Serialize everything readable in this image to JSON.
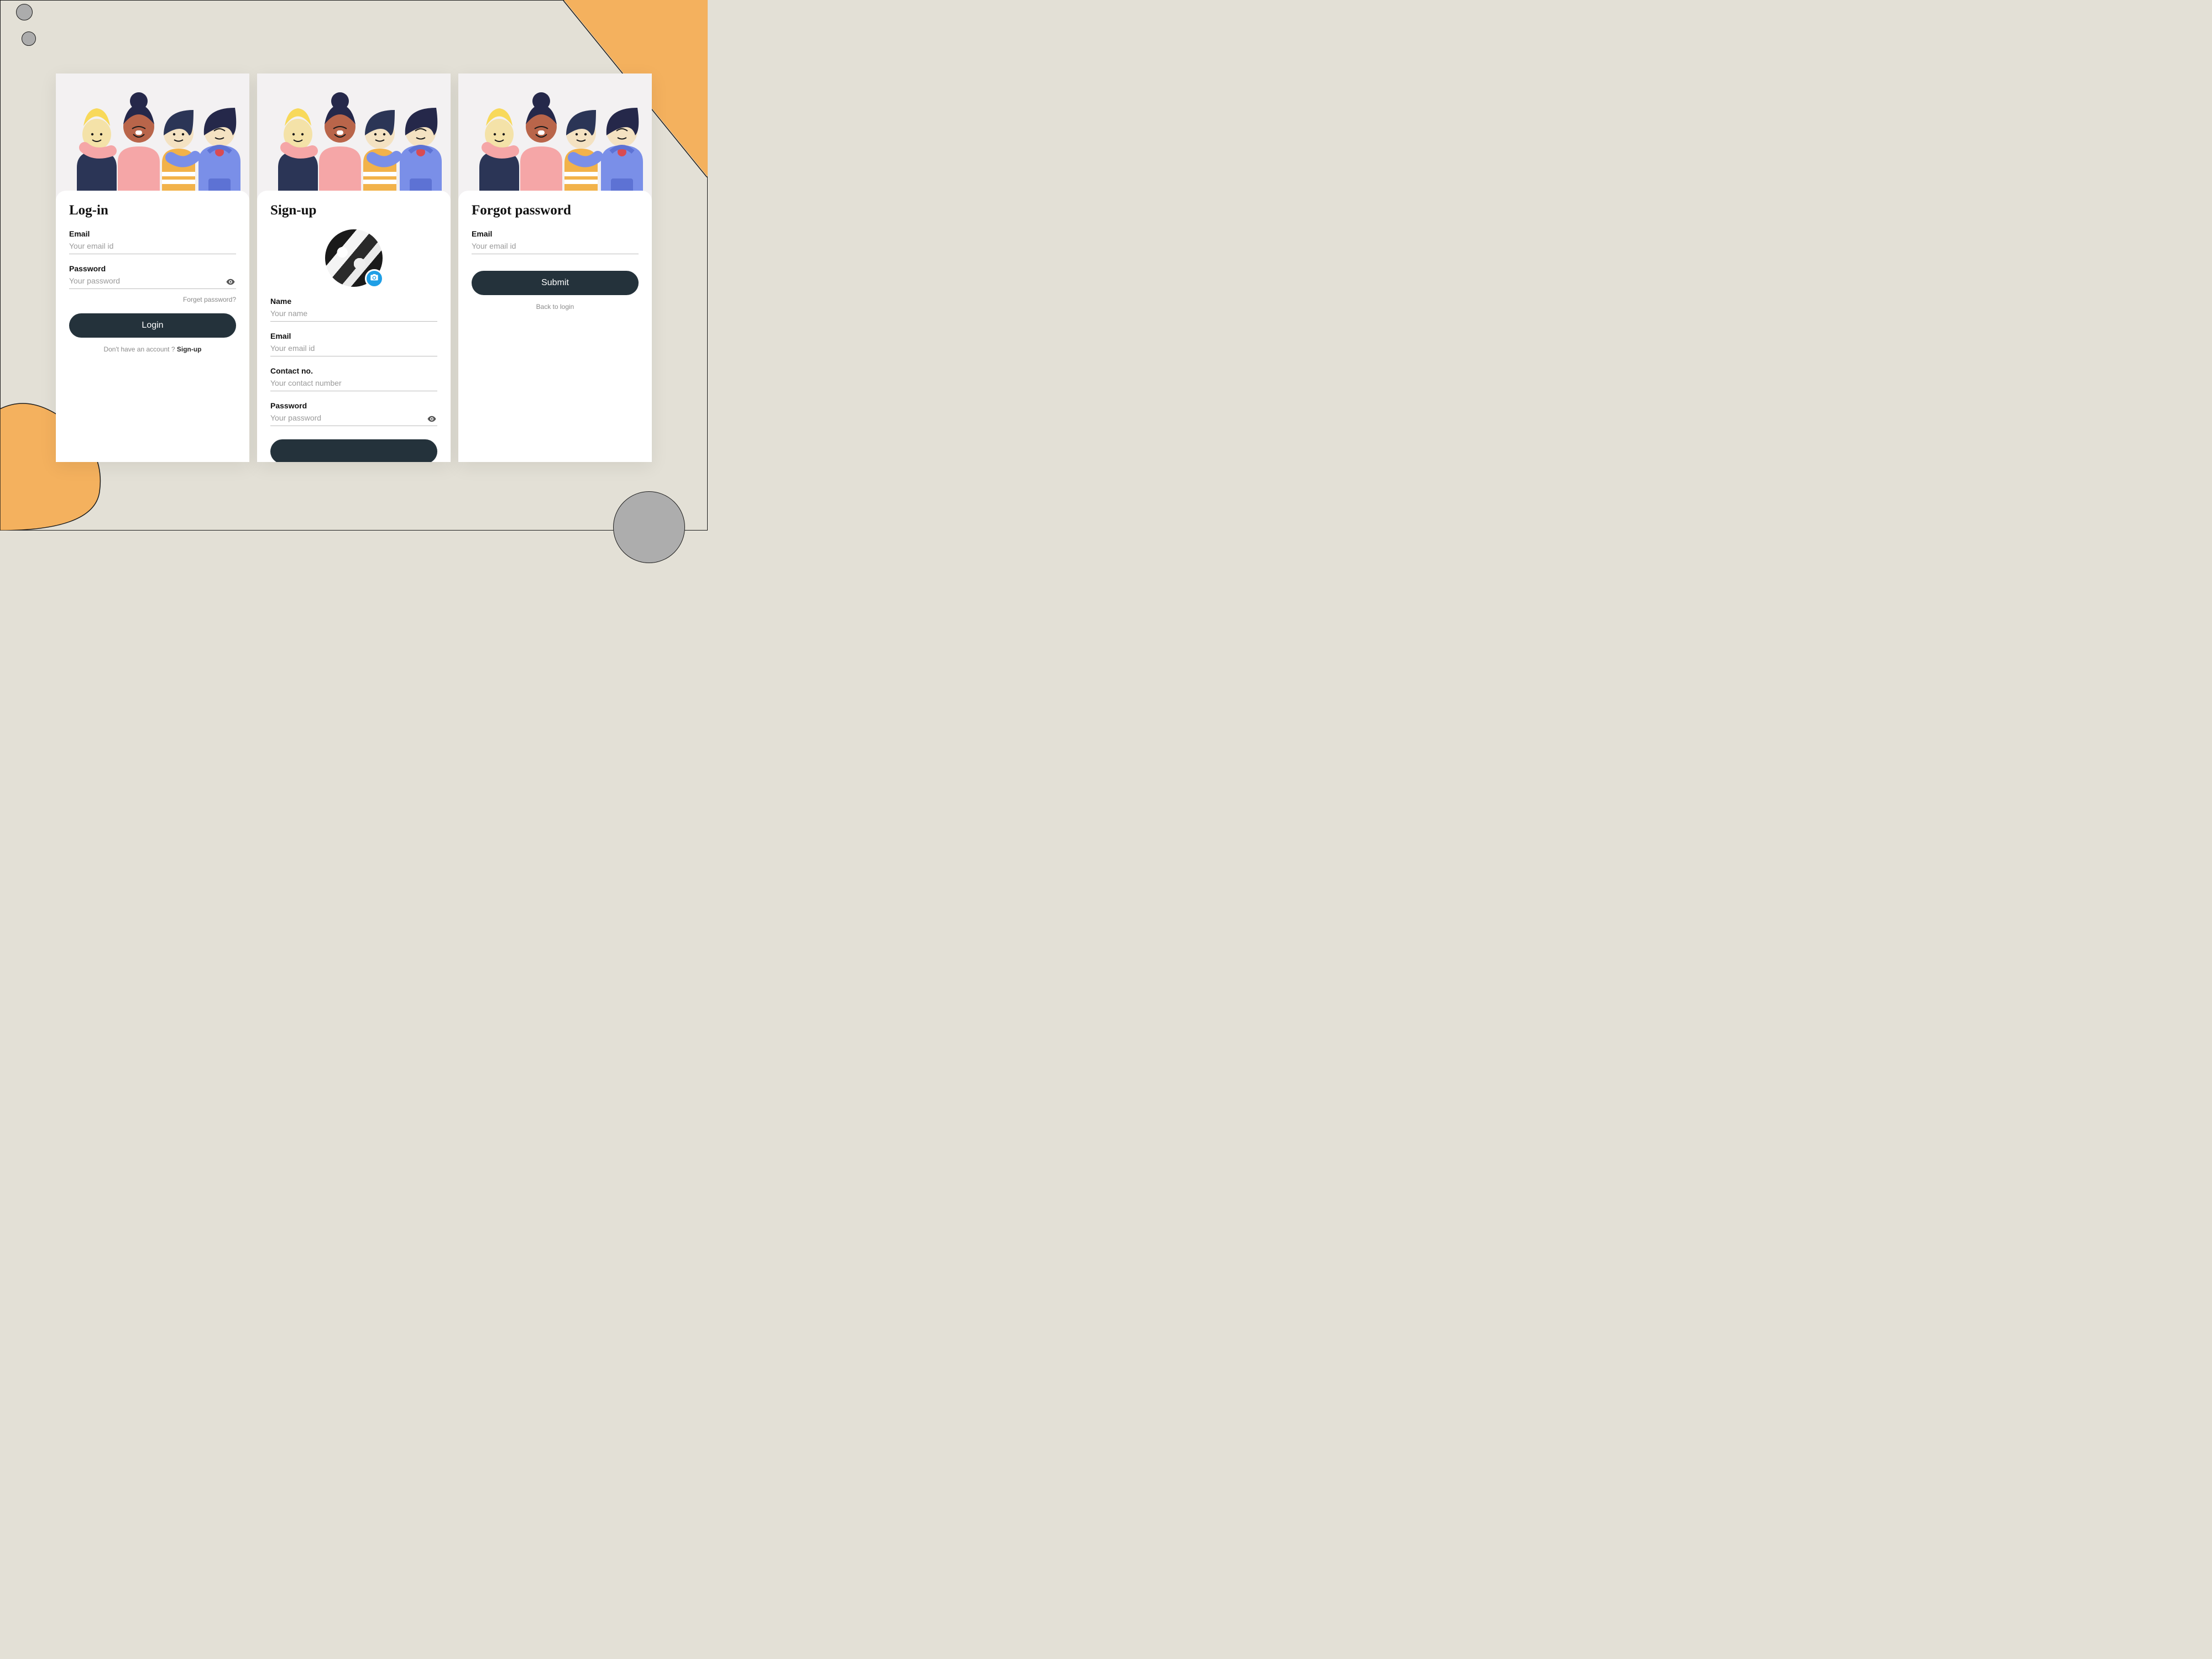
{
  "screens": {
    "login": {
      "title": "Log-in",
      "email_label": "Email",
      "email_placeholder": "Your email id",
      "password_label": "Password",
      "password_placeholder": "Your password",
      "forgot_link": "Forget password?",
      "submit_label": "Login",
      "no_account_prefix": "Don't have an account ? ",
      "signup_link": "Sign-up"
    },
    "signup": {
      "title": "Sign-up",
      "name_label": "Name",
      "name_placeholder": "Your name",
      "email_label": "Email",
      "email_placeholder": "Your email id",
      "contact_label": "Contact no.",
      "contact_placeholder": "Your contact number",
      "password_label": "Password",
      "password_placeholder": "Your password"
    },
    "forgot": {
      "title": "Forgot password",
      "email_label": "Email",
      "email_placeholder": "Your email id",
      "submit_label": "Submit",
      "back_link": "Back to login"
    }
  },
  "colors": {
    "primary_button": "#24323b",
    "accent_blue": "#1f9fe6",
    "background": "#e3e0d6",
    "accent_orange": "#f4b15e"
  }
}
